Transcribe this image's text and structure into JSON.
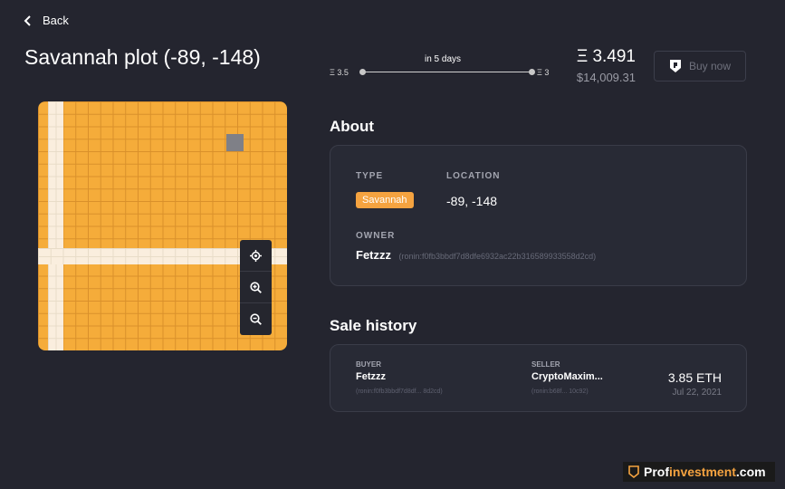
{
  "nav": {
    "back_label": "Back"
  },
  "page": {
    "title": "Savannah plot (-89, -148)"
  },
  "auction": {
    "time_label": "in 5 days",
    "start_price": "Ξ 3.5",
    "end_price": "Ξ 3"
  },
  "price": {
    "eth": "Ξ 3.491",
    "usd": "$14,009.31"
  },
  "buy_label": "Buy now",
  "about": {
    "heading": "About",
    "type_label": "TYPE",
    "type_value": "Savannah",
    "location_label": "LOCATION",
    "location_value": "-89, -148",
    "owner_label": "OWNER",
    "owner_name": "Fetzzz",
    "owner_address": "(ronin:f0fb3bbdf7d8dfe6932ac22b316589933558d2cd)"
  },
  "sale_history": {
    "heading": "Sale history",
    "rows": [
      {
        "buyer_label": "BUYER",
        "buyer_name": "Fetzzz",
        "buyer_address": "(ronin:f0fb3bbdf7d8df... 8d2cd)",
        "seller_label": "SELLER",
        "seller_name": "CryptoMaxim...",
        "seller_address": "(ronin:b68f... 10c92)",
        "amount": "3.85 ETH",
        "date": "Jul 22, 2021"
      }
    ]
  },
  "watermark": {
    "part1": "Prof",
    "part2": "investment",
    "part3": ".com"
  },
  "colors": {
    "accent_orange": "#f5a340",
    "background": "#24252f",
    "card": "#282a35"
  },
  "icons": {
    "back": "chevron-left-icon",
    "buy": "shield-icon",
    "locate": "crosshair-icon",
    "zoom_in": "zoom-in-icon",
    "zoom_out": "zoom-out-icon"
  }
}
